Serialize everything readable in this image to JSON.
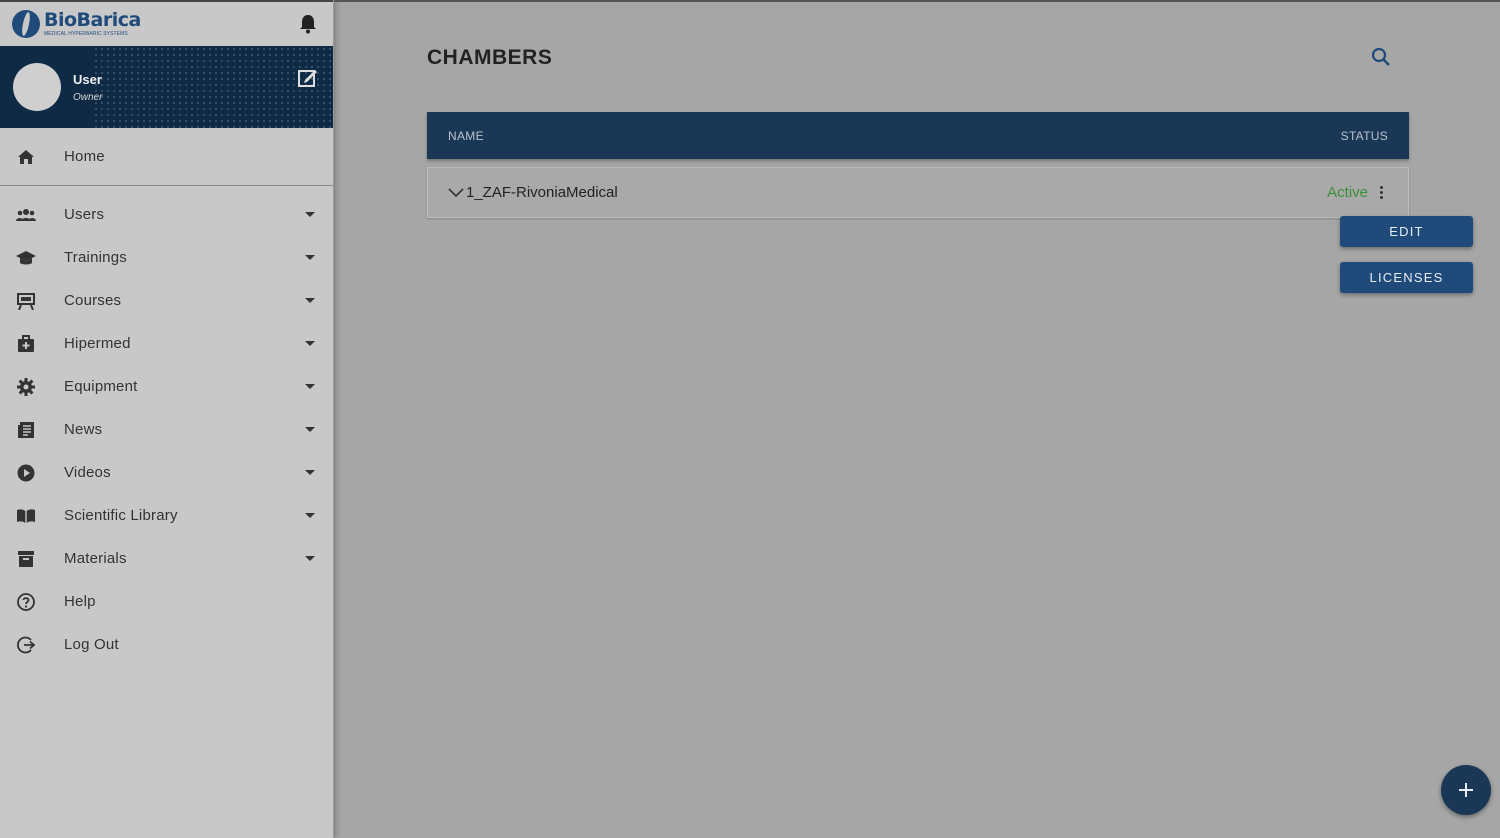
{
  "brand": {
    "name": "BioBarica",
    "subtitle": "MEDICAL HYPERBARIC SYSTEMS",
    "color": "#1f4a7a"
  },
  "profile": {
    "name": "User",
    "role": "Owner"
  },
  "nav": [
    {
      "label": "Home",
      "icon": "home-icon",
      "expandable": false
    },
    {
      "label": "Users",
      "icon": "users-icon",
      "expandable": true
    },
    {
      "label": "Trainings",
      "icon": "graduation-cap-icon",
      "expandable": true
    },
    {
      "label": "Courses",
      "icon": "easel-icon",
      "expandable": true
    },
    {
      "label": "Hipermed",
      "icon": "medical-kit-icon",
      "expandable": true
    },
    {
      "label": "Equipment",
      "icon": "gear-icon",
      "expandable": true
    },
    {
      "label": "News",
      "icon": "newspaper-icon",
      "expandable": true
    },
    {
      "label": "Videos",
      "icon": "play-circle-icon",
      "expandable": true
    },
    {
      "label": "Scientific Library",
      "icon": "book-icon",
      "expandable": true
    },
    {
      "label": "Materials",
      "icon": "archive-icon",
      "expandable": true
    },
    {
      "label": "Help",
      "icon": "help-circle-icon",
      "expandable": false
    },
    {
      "label": "Log Out",
      "icon": "logout-icon",
      "expandable": false
    }
  ],
  "page": {
    "title": "CHAMBERS"
  },
  "table": {
    "headers": {
      "name": "NAME",
      "status": "STATUS"
    },
    "rows": [
      {
        "name": "1_ZAF-RivoniaMedical",
        "status": "Active"
      }
    ]
  },
  "row_menu": {
    "edit": "EDIT",
    "licenses": "LICENSES"
  },
  "colors": {
    "header_bg": "#1a3755",
    "active_status": "#3b8f3b",
    "profile_bg": "#0e2a44"
  }
}
